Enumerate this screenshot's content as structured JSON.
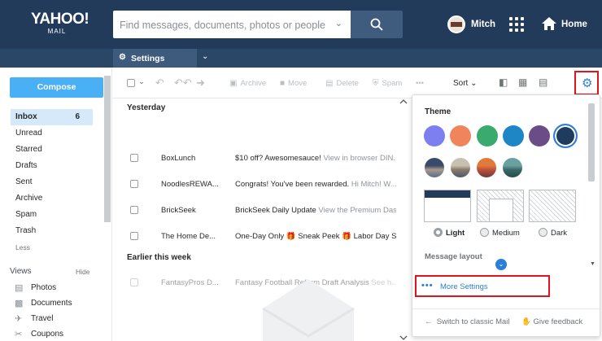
{
  "header": {
    "logo_line1": "YAHOO!",
    "logo_line2": "MAIL",
    "search_placeholder": "Find messages, documents, photos or people",
    "username": "Mitch",
    "home_label": "Home"
  },
  "tabbar": {
    "settings_tab": "Settings"
  },
  "sidebar": {
    "compose": "Compose",
    "folders": [
      {
        "label": "Inbox",
        "count": "6",
        "active": true
      },
      {
        "label": "Unread"
      },
      {
        "label": "Starred"
      },
      {
        "label": "Drafts"
      },
      {
        "label": "Sent"
      },
      {
        "label": "Archive"
      },
      {
        "label": "Spam"
      },
      {
        "label": "Trash"
      }
    ],
    "less": "Less",
    "views_title": "Views",
    "views_hide": "Hide",
    "views": [
      {
        "label": "Photos",
        "icon": "photo-icon"
      },
      {
        "label": "Documents",
        "icon": "document-icon"
      },
      {
        "label": "Travel",
        "icon": "plane-icon"
      },
      {
        "label": "Coupons",
        "icon": "scissors-icon"
      }
    ]
  },
  "toolbar": {
    "archive": "Archive",
    "move": "Move",
    "delete": "Delete",
    "spam": "Spam",
    "more": "•••",
    "sort": "Sort"
  },
  "messages": {
    "group1": "Yesterday",
    "group2": "Earlier this week",
    "rows": [
      {
        "from": "BoxLunch",
        "subject": "$10 off? Awesomesauce!",
        "snippet": " View in browser DIN..."
      },
      {
        "from": "NoodlesREWA...",
        "subject": "Congrats! You've been rewarded.",
        "snippet": " Hi Mitch! W..."
      },
      {
        "from": "BrickSeek",
        "subject": "BrickSeek Daily Update",
        "snippet": " View the Premium Das..."
      },
      {
        "from": "The Home De...",
        "subject": "One-Day Only 🎁 Sneak Peek 🎁 Labor Day Sa...",
        "snippet": ""
      },
      {
        "from": "FantasyPros D...",
        "subject": "Fantasy Football Reform Draft Analysis",
        "snippet": " See h..."
      }
    ]
  },
  "settings_panel": {
    "theme_title": "Theme",
    "theme_colors": [
      "#7b7ff0",
      "#f0845a",
      "#3aaa6e",
      "#1e86c4",
      "#6a4d86",
      "#1f3b5e"
    ],
    "layout_options": {
      "light": "Light",
      "medium": "Medium",
      "dark": "Dark"
    },
    "message_layout": "Message layout",
    "more_settings": "More Settings",
    "switch_classic": "Switch to classic Mail",
    "give_feedback": "Give feedback"
  }
}
